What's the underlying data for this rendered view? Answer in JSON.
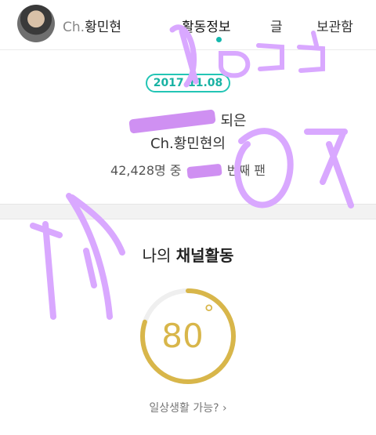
{
  "header": {
    "channel_prefix": "Ch.",
    "channel_name": "황민현",
    "tabs": [
      {
        "label": "활동정보",
        "active": true
      },
      {
        "label": "글",
        "active": false
      },
      {
        "label": "보관함",
        "active": false
      }
    ],
    "active_indicator_color": "#14b8ad"
  },
  "summary": {
    "date": "2017.11.08",
    "fan_suffix": "되은",
    "fan_channel_prefix": "Ch.",
    "fan_channel_name": "황민현의",
    "rank_count": "42,428명 중",
    "rank_suffix": "번째 팬"
  },
  "activity": {
    "title_prefix": "나의",
    "title_bold": "채널활동",
    "gauge_value": "80",
    "gauge_unit": "°",
    "gauge_level": 0.8,
    "gauge_color": "#d8b64a",
    "link_label": "일상생활 가능? ›"
  },
  "colors": {
    "accent": "#23c5b5",
    "redaction": "#c77df0",
    "scribble": "#d9a8ff"
  }
}
